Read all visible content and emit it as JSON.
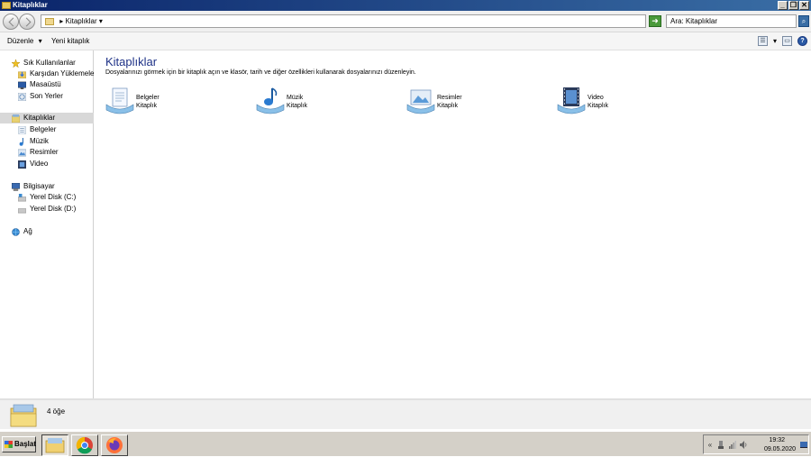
{
  "window": {
    "title": "Kitaplıklar",
    "minimize": "_",
    "restore": "❐",
    "close": "✕"
  },
  "address": {
    "path_arrow": "▸",
    "path": "Kitaplıklar",
    "dropdown": "▾",
    "go": "➜",
    "search_value": "Ara: Kitaplıklar",
    "search_glyph": "⌕"
  },
  "toolbar": {
    "organize": "Düzenle",
    "organize_arrow": "▾",
    "new_library": "Yeni kitaplık",
    "view_glyph": "☰",
    "view_arrow": "▾",
    "pane_glyph": "▭",
    "help_glyph": "?"
  },
  "sidebar": {
    "favorites": "Sık Kullanılanlar",
    "downloads": "Karşıdan Yüklemeler",
    "desktop": "Masaüstü",
    "recent": "Son Yerler",
    "libraries": "Kitaplıklar",
    "documents": "Belgeler",
    "music": "Müzik",
    "pictures": "Resimler",
    "video": "Video",
    "computer": "Bilgisayar",
    "drive_c": "Yerel Disk (C:)",
    "drive_d": "Yerel Disk (D:)",
    "network": "Ağ"
  },
  "content": {
    "heading": "Kitaplıklar",
    "subtitle": "Dosyalarınızı görmek için bir kitaplık açın ve klasör, tarih ve diğer özellikleri kullanarak dosyalarınızı düzenleyin.",
    "libraries": [
      {
        "name": "Belgeler",
        "type": "Kitaplık"
      },
      {
        "name": "Müzik",
        "type": "Kitaplık"
      },
      {
        "name": "Resimler",
        "type": "Kitaplık"
      },
      {
        "name": "Video",
        "type": "Kitaplık"
      }
    ]
  },
  "details": {
    "item_count": "4 öğe"
  },
  "taskbar": {
    "start": "Başlat",
    "time": "19:32",
    "date": "09.05.2020",
    "tray_up": "«"
  },
  "colors": {
    "heading": "#1e3287",
    "selected_nav": "#d8d8d8",
    "titlebar_start": "#0a246a",
    "titlebar_end": "#3a6ea5"
  }
}
